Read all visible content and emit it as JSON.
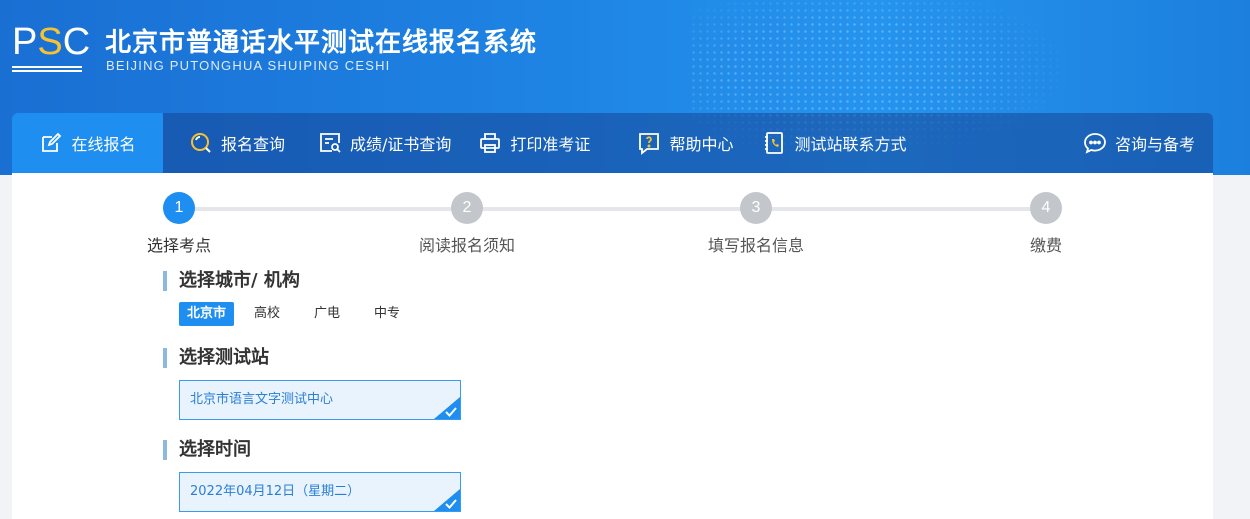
{
  "header": {
    "logo_text": "PSC",
    "title": "北京市普通话水平测试在线报名系统",
    "subtitle": "BEIJING PUTONGHUA SHUIPING CESHI"
  },
  "nav": {
    "items": [
      {
        "label": "在线报名",
        "icon": "edit-icon",
        "active": true
      },
      {
        "label": "报名查询",
        "icon": "search-icon"
      },
      {
        "label": "成绩/证书查询",
        "icon": "certificate-search-icon"
      },
      {
        "label": "打印准考证",
        "icon": "printer-icon"
      },
      {
        "label": "帮助中心",
        "icon": "help-icon"
      },
      {
        "label": "测试站联系方式",
        "icon": "phone-book-icon"
      },
      {
        "label": "咨询与备考",
        "icon": "chat-icon"
      }
    ]
  },
  "steps": [
    {
      "number": "1",
      "label": "选择考点",
      "active": true
    },
    {
      "number": "2",
      "label": "阅读报名须知"
    },
    {
      "number": "3",
      "label": "填写报名信息"
    },
    {
      "number": "4",
      "label": "缴费"
    }
  ],
  "city_section": {
    "title": "选择城市/ 机构",
    "tabs": [
      "北京市",
      "高校",
      "广电",
      "中专"
    ],
    "selected": "北京市"
  },
  "station_section": {
    "title": "选择测试站",
    "selected": "北京市语言文字测试中心"
  },
  "time_section": {
    "title": "选择时间",
    "selected": "2022年04月12日（星期二）"
  },
  "colors": {
    "primary": "#1e8ff0",
    "header_bg": "#1a6fd3",
    "logo_accent": "#f6c234",
    "step_inactive": "#c3c7cc"
  }
}
